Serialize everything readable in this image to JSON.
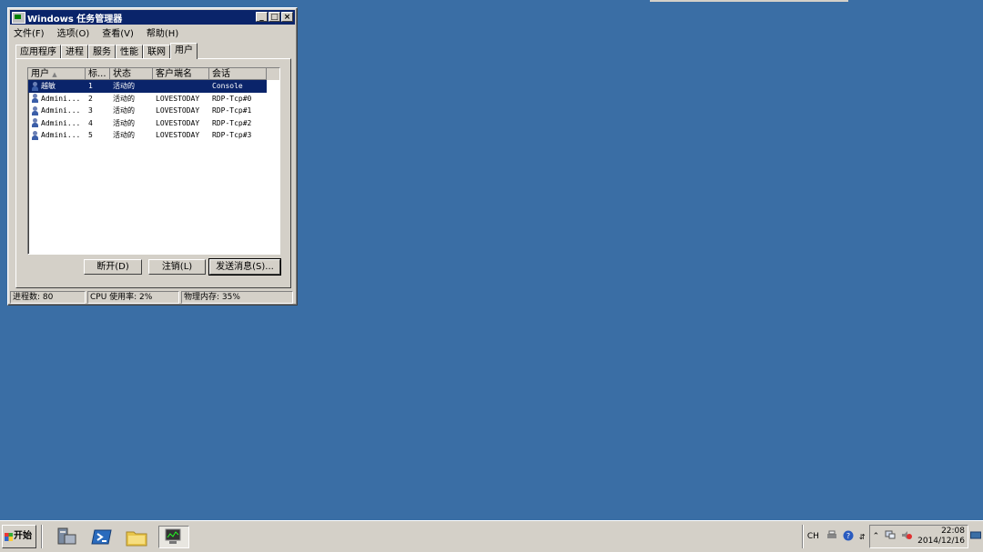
{
  "window": {
    "title": "Windows 任务管理器",
    "controls": {
      "minimize": "_",
      "maximize": "□",
      "close": "×"
    }
  },
  "menu": [
    "文件(F)",
    "选项(O)",
    "查看(V)",
    "帮助(H)"
  ],
  "tabs": [
    "应用程序",
    "进程",
    "服务",
    "性能",
    "联网",
    "用户"
  ],
  "active_tab": "用户",
  "table": {
    "columns": [
      "用户",
      "标...",
      "状态",
      "客户端名",
      "会话"
    ],
    "sort_indicator": "▲",
    "rows": [
      {
        "user": "越敏",
        "id": "1",
        "status": "活动的",
        "client": "",
        "session": "Console",
        "selected": true
      },
      {
        "user": "Admini...",
        "id": "2",
        "status": "活动的",
        "client": "LOVESTODAY",
        "session": "RDP-Tcp#0"
      },
      {
        "user": "Admini...",
        "id": "3",
        "status": "活动的",
        "client": "LOVESTODAY",
        "session": "RDP-Tcp#1"
      },
      {
        "user": "Admini...",
        "id": "4",
        "status": "活动的",
        "client": "LOVESTODAY",
        "session": "RDP-Tcp#2"
      },
      {
        "user": "Admini...",
        "id": "5",
        "status": "活动的",
        "client": "LOVESTODAY",
        "session": "RDP-Tcp#3"
      }
    ]
  },
  "buttons": {
    "disconnect": "断开(D)",
    "logoff": "注销(L)",
    "send_message": "发送消息(S)..."
  },
  "status": {
    "processes": "进程数: 80",
    "cpu": "CPU 使用率: 2%",
    "memory": "物理内存: 35%"
  },
  "taskbar": {
    "start_label": "开始",
    "quicklaunch": [
      "server-manager-icon",
      "powershell-icon",
      "explorer-folder-icon",
      "task-manager-icon"
    ],
    "lang": "CH",
    "time": "22:08",
    "date": "2014/12/16"
  }
}
